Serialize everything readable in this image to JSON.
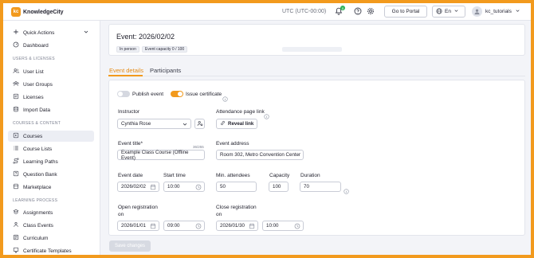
{
  "app": {
    "brand": "KnowledgeCity",
    "logo_mark": "kc"
  },
  "topbar": {
    "timezone": "UTC (UTC-00:00)",
    "notification_count": "0",
    "portal_button": "Go to Portal",
    "language": "En",
    "username": "kc_tutorials"
  },
  "sidebar": {
    "quick_actions": "Quick Actions",
    "dashboard": "Dashboard",
    "section_users": "USERS & LICENSES",
    "user_list": "User List",
    "user_groups": "User Groups",
    "licenses": "Licenses",
    "import_data": "Import Data",
    "section_courses": "COURSES & CONTENT",
    "courses": "Courses",
    "course_lists": "Course Lists",
    "learning_paths": "Learning Paths",
    "question_bank": "Question Bank",
    "marketplace": "Marketplace",
    "section_learning": "LEARNING PROCESS",
    "assignments": "Assignments",
    "class_events": "Class Events",
    "curriculum": "Curriculum",
    "certificate_templates": "Certificate Templates"
  },
  "event": {
    "title": "Event: 2026/02/02",
    "mode_chip": "In person",
    "capacity_chip": "Event capacity 0 / 100",
    "capacity_fraction": 0
  },
  "tabs": {
    "details": "Event details",
    "participants": "Participants"
  },
  "form": {
    "publish_label": "Publish event",
    "publish_on": false,
    "certificate_label": "Issue certificate",
    "certificate_on": true,
    "instructor_label": "Instructor",
    "instructor_value": "Cynthia Rose",
    "attendance_label": "Attendance page link",
    "reveal_link": "Reveal link",
    "event_title_label": "Event title*",
    "event_title_counter": "36/255",
    "event_title_value": "Example Class Course (Offline Event)",
    "event_address_label": "Event address",
    "event_address_value": "Room 302, Metro Convention Center",
    "event_date_label": "Event date",
    "event_date_value": "2026/02/02",
    "start_time_label": "Start time",
    "start_time_value": "10:00",
    "min_attendees_label": "Min. attendees",
    "min_attendees_value": "50",
    "capacity_label": "Capacity",
    "capacity_value": "100",
    "duration_label": "Duration",
    "duration_value": "70",
    "open_reg_label": "Open registration on",
    "open_reg_date": "2026/01/01",
    "open_reg_time": "09:00",
    "close_reg_label": "Close registration on",
    "close_reg_date": "2026/01/30",
    "close_reg_time": "10:00"
  },
  "footer": {
    "save_button": "Save changes"
  },
  "colors": {
    "accent": "#f29a1d",
    "frame": "#f29a1d"
  }
}
